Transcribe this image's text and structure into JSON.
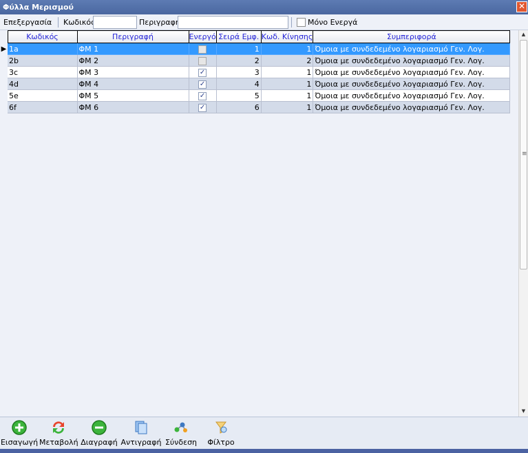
{
  "window": {
    "title": "Φύλλα Μερισμού",
    "close_glyph": "✕"
  },
  "toolbar": {
    "edit_label": "Επεξεργασία",
    "code_label": "Κωδικός",
    "code_value": "",
    "desc_label": "Περιγραφή",
    "desc_value": "",
    "only_active_label": "Μόνο Ενεργά",
    "only_active_checked": false
  },
  "grid": {
    "columns": [
      "Κωδικός",
      "Περιγραφή",
      "Ενεργό",
      "Σειρά Εμφ.",
      "Κωδ. Κίνησης",
      "Συμπεριφορά"
    ],
    "current_row_glyph": "▶",
    "rows": [
      {
        "code": "1a",
        "desc": "ΦΜ 1",
        "active": false,
        "order": "1",
        "move_code": "1",
        "behavior": "Όμοια με συνδεδεμένο λογαριασμό Γεν. Λογ.",
        "selected": true
      },
      {
        "code": "2b",
        "desc": "ΦΜ 2",
        "active": false,
        "order": "2",
        "move_code": "2",
        "behavior": "Όμοια με συνδεδεμένο λογαριασμό Γεν. Λογ.",
        "selected": false
      },
      {
        "code": "3c",
        "desc": "ΦΜ 3",
        "active": true,
        "order": "3",
        "move_code": "1",
        "behavior": "Όμοια με συνδεδεμένο λογαριασμό Γεν. Λογ.",
        "selected": false
      },
      {
        "code": "4d",
        "desc": "ΦΜ 4",
        "active": true,
        "order": "4",
        "move_code": "1",
        "behavior": "Όμοια με συνδεδεμένο λογαριασμό Γεν. Λογ.",
        "selected": false
      },
      {
        "code": "5e",
        "desc": "ΦΜ 5",
        "active": true,
        "order": "5",
        "move_code": "1",
        "behavior": "Όμοια με συνδεδεμένο λογαριασμό Γεν. Λογ.",
        "selected": false
      },
      {
        "code": "6f",
        "desc": "ΦΜ 6",
        "active": true,
        "order": "6",
        "move_code": "1",
        "behavior": "Όμοια με συνδεδεμένο λογαριασμό Γεν. Λογ.",
        "selected": false
      }
    ]
  },
  "scrollbar": {
    "up_glyph": "▲",
    "down_glyph": "▼",
    "grip_glyph": "≡"
  },
  "actions": [
    {
      "name": "insert-button",
      "icon": "add-circle-icon",
      "label": "Εισαγωγή"
    },
    {
      "name": "modify-button",
      "icon": "refresh-arrows-icon",
      "label": "Μεταβολή"
    },
    {
      "name": "delete-button",
      "icon": "remove-circle-icon",
      "label": "Διαγραφή"
    },
    {
      "name": "copy-button",
      "icon": "copy-pages-icon",
      "label": "Αντιγραφή"
    },
    {
      "name": "link-button",
      "icon": "link-nodes-icon",
      "label": "Σύνδεση"
    },
    {
      "name": "filter-button",
      "icon": "funnel-icon",
      "label": "Φίλτρο"
    }
  ],
  "colors": {
    "title_bar": "#4a67a0",
    "selected_row": "#3399ff",
    "alt_row": "#d3dbe9",
    "header_text": "#2424d8",
    "close_button": "#e2572f"
  }
}
